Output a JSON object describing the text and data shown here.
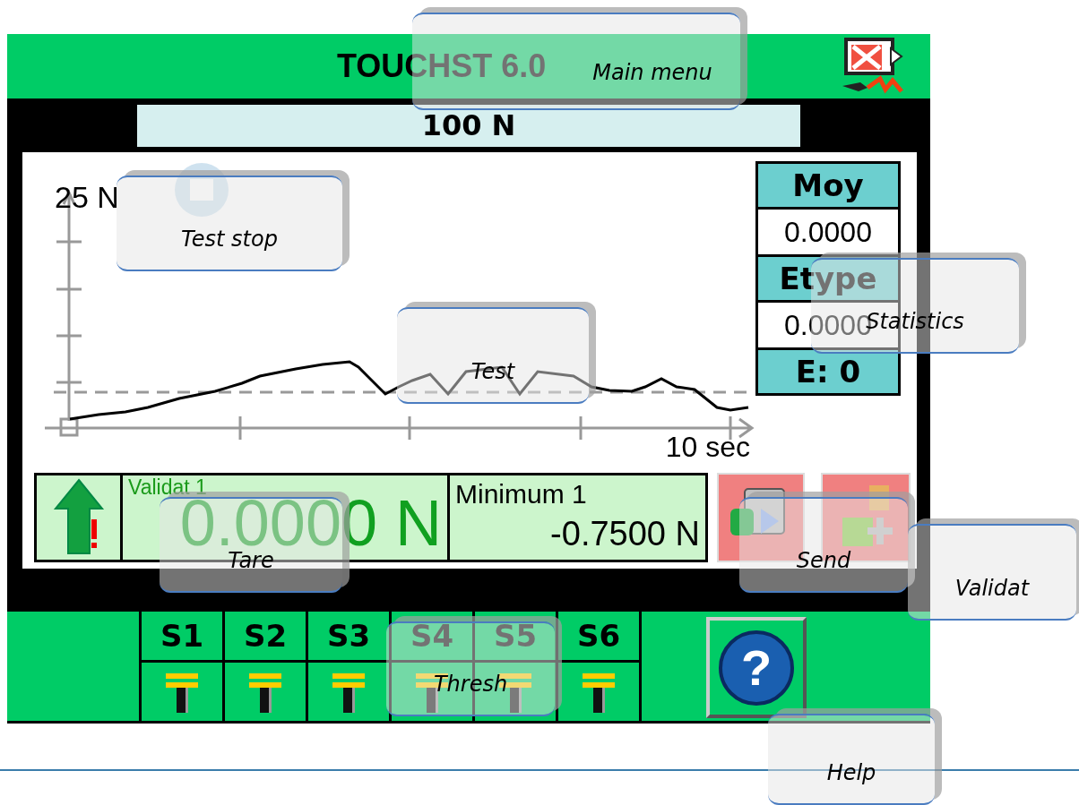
{
  "header": {
    "title": "TOUCHST 6.0"
  },
  "setpoint": "100 N",
  "chart": {
    "y_label": "25 N",
    "x_label": "10 sec"
  },
  "statistics": [
    {
      "kind": "heading",
      "text": "Moy"
    },
    {
      "kind": "value",
      "text": "0.0000"
    },
    {
      "kind": "heading",
      "text": "Etype"
    },
    {
      "kind": "value",
      "text": "0.0000"
    },
    {
      "kind": "heading",
      "text": "E: 0"
    }
  ],
  "measure": {
    "label": "Validat 1",
    "value": "0.0000 N",
    "min_label": "Minimum 1",
    "min_value": "-0.7500 N"
  },
  "thresholds": [
    {
      "label": "S1"
    },
    {
      "label": "S2"
    },
    {
      "label": "S3"
    },
    {
      "label": "S4"
    },
    {
      "label": "S5"
    },
    {
      "label": "S6"
    }
  ],
  "help": {
    "glyph": "?"
  },
  "callouts": [
    {
      "text": "Main menu"
    },
    {
      "text": "Test stop"
    },
    {
      "text": "Test"
    },
    {
      "text": "Statistics"
    },
    {
      "text": "Tare"
    },
    {
      "text": "Send"
    },
    {
      "text": "Validat"
    },
    {
      "text": "Thresh"
    },
    {
      "text": "Help"
    }
  ]
}
